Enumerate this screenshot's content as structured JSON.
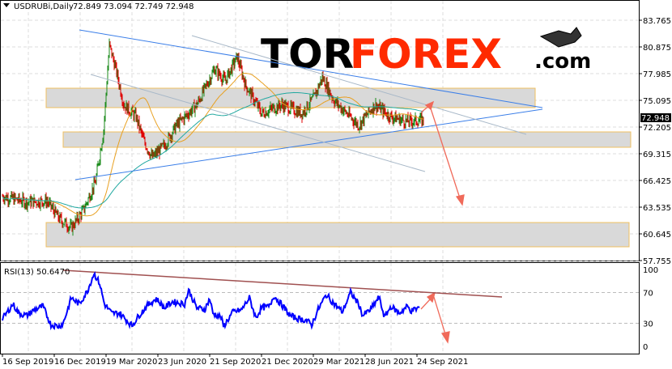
{
  "header": {
    "symbol": "USDRUBi,Daily",
    "ohlc": "72.849 73.094 72.749 72.948",
    "menu_icon": "triangle-down-icon"
  },
  "logo": {
    "part1": "TOR",
    "part2": "FOREX",
    "part3": ".com",
    "icon": "bull-icon"
  },
  "colors": {
    "up": "#1a8a1a",
    "down": "#e00000",
    "ma_fast": "#e8a020",
    "ma_slow": "#20a8a0",
    "rsi": "#0000ff",
    "trend": "#3a7ee8",
    "zone_fill": "#d9d9d9",
    "zone_border": "#f0c060",
    "arrow": "#f06a5a"
  },
  "chart_data": [
    {
      "type": "candlestick",
      "title": "USDRUBi,Daily",
      "last_price": "72.948",
      "y_ticks": [
        "83.765",
        "80.875",
        "77.985",
        "75.095",
        "72.205",
        "69.315",
        "66.425",
        "63.535",
        "60.645",
        "57.755"
      ],
      "ylim": [
        57.755,
        83.765
      ],
      "x_ticks": [
        "16 Sep 2019",
        "16 Dec 2019",
        "19 Mar 2020",
        "23 Jun 2020",
        "21 Sep 2020",
        "21 Dec 2020",
        "29 Mar 2021",
        "28 Jun 2021",
        "24 Sep 2021"
      ],
      "close_keypoints": {
        "bar": [
          0,
          30,
          55,
          70,
          85,
          100,
          115,
          125,
          132,
          140,
          150,
          165,
          175,
          185,
          200,
          215,
          240,
          262,
          275,
          290,
          300,
          320,
          345,
          370,
          385,
          395,
          410,
          440,
          460,
          480,
          500,
          520
        ],
        "price": [
          64.7,
          64.1,
          64.2,
          62.3,
          61.3,
          63.2,
          66.3,
          71.9,
          81.1,
          78.5,
          74.6,
          73.3,
          70.6,
          68.9,
          70.2,
          72.4,
          74.6,
          78.5,
          77.2,
          79.8,
          76.8,
          73.7,
          74.6,
          73.7,
          75.4,
          77.6,
          75.0,
          72.4,
          74.6,
          73.3,
          72.8,
          72.95
        ]
      },
      "zones": [
        [
          74.3,
          76.4
        ],
        [
          70.0,
          71.7
        ],
        [
          59.3,
          61.9
        ]
      ],
      "grid": true
    },
    {
      "type": "line",
      "title": "RSI(13) 50.6470",
      "y_ticks": [
        "100",
        "70",
        "30",
        "0"
      ],
      "ylim": [
        0,
        100
      ],
      "levels": [
        70,
        30
      ],
      "keypoints": {
        "bar": [
          0,
          3,
          13,
          20,
          30,
          40,
          50,
          55,
          60,
          70,
          75,
          80,
          85,
          95,
          105,
          113,
          120,
          126,
          135,
          145,
          155,
          160,
          170,
          180,
          190,
          200,
          210,
          225,
          230,
          240,
          250,
          256,
          260,
          270,
          273,
          285,
          295,
          305,
          313,
          320,
          330,
          335,
          345,
          355,
          365,
          375,
          382,
          390,
          400,
          410,
          420,
          430,
          440,
          445,
          455,
          465,
          472,
          480,
          490,
          500,
          505,
          515
        ],
        "value": [
          36,
          40,
          55,
          43,
          40,
          48,
          52,
          40,
          28,
          26,
          30,
          46,
          63,
          55,
          72,
          95,
          82,
          55,
          43,
          43,
          32,
          27,
          42,
          54,
          62,
          50,
          58,
          55,
          73,
          50,
          48,
          62,
          43,
          38,
          26,
          45,
          47,
          63,
          37,
          50,
          52,
          66,
          54,
          40,
          36,
          34,
          28,
          48,
          67,
          55,
          45,
          70,
          55,
          40,
          48,
          64,
          38,
          52,
          43,
          52,
          46,
          50.6
        ]
      }
    }
  ]
}
